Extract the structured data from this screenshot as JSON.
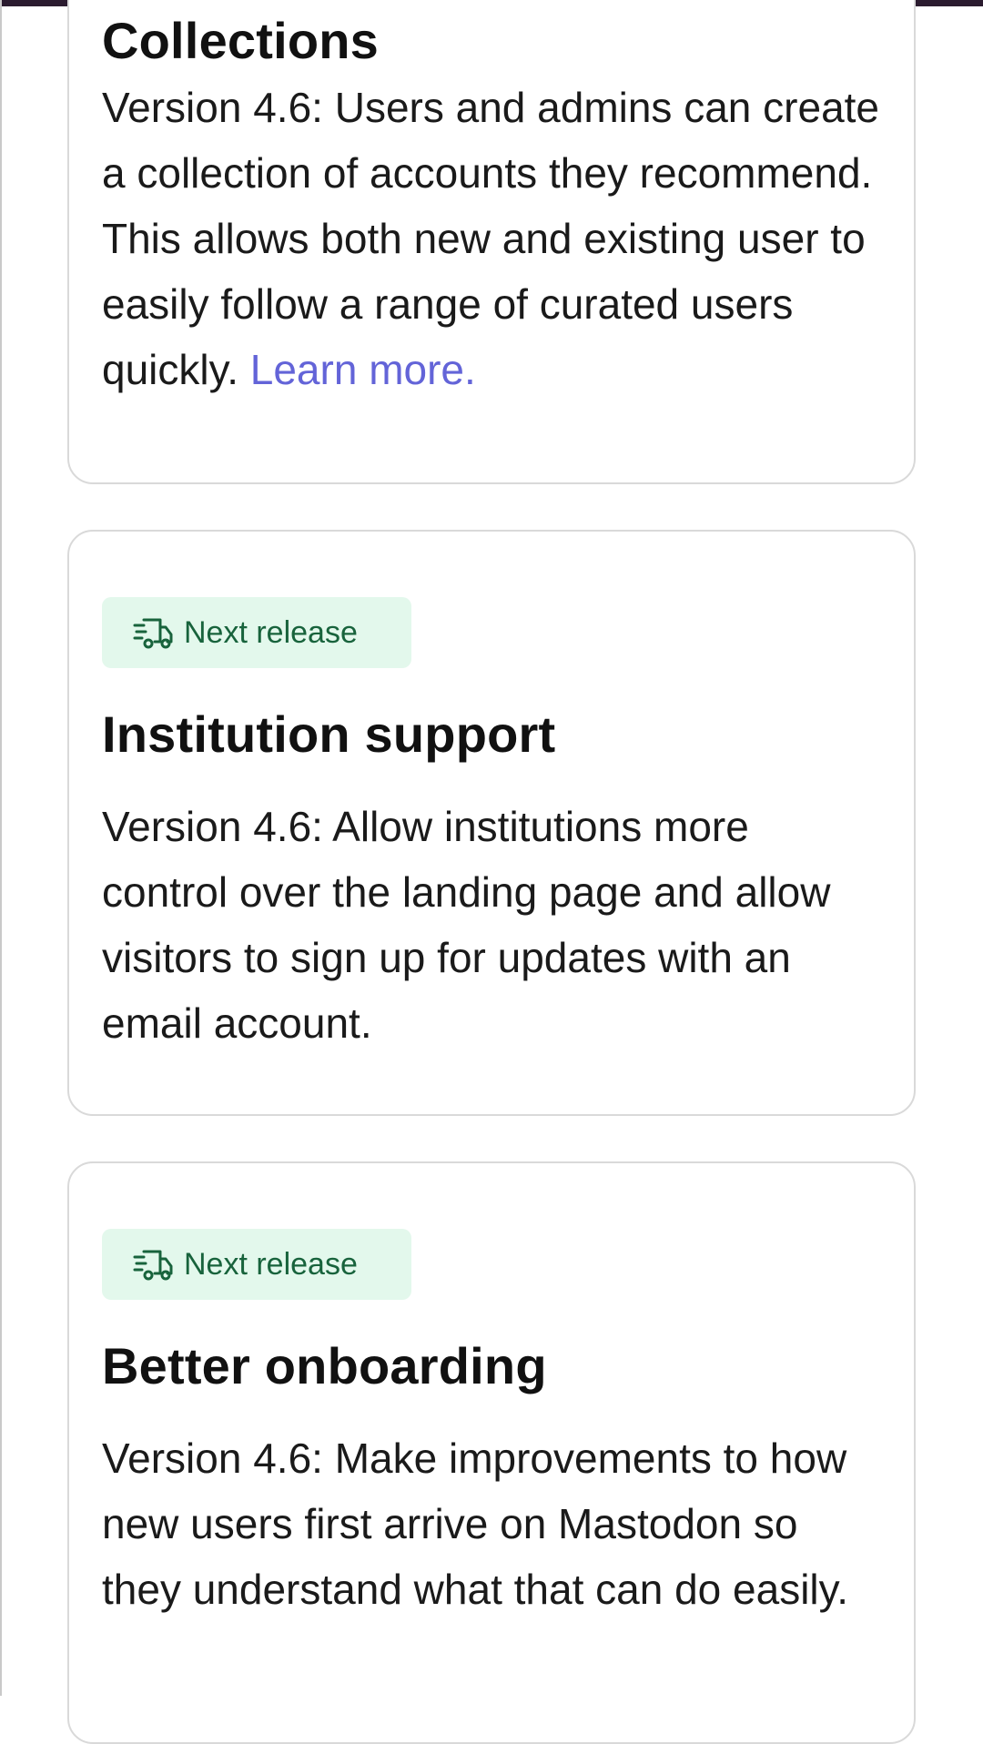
{
  "cards": [
    {
      "title": "Collections",
      "description": "Version 4.6: Users and admins can create a collection of accounts they recommend. This allows both new and existing user to easily follow a range of curated users quickly.",
      "link": "Learn more."
    },
    {
      "badge": "Next release",
      "badge_icon": "delivery-truck-icon",
      "title": "Institution support",
      "description": "Version 4.6: Allow institutions more control over the landing page and allow visitors to sign up for updates with an email account."
    },
    {
      "badge": "Next release",
      "badge_icon": "delivery-truck-icon",
      "title": "Better onboarding",
      "description": "Version 4.6: Make improvements to how new users first arrive on Mastodon so they understand what that can do easily."
    }
  ],
  "colors": {
    "accent_link": "#6364d8",
    "badge_bg": "#e3f8ec",
    "badge_text": "#18633c",
    "top_bar": "#2b1b2f"
  }
}
